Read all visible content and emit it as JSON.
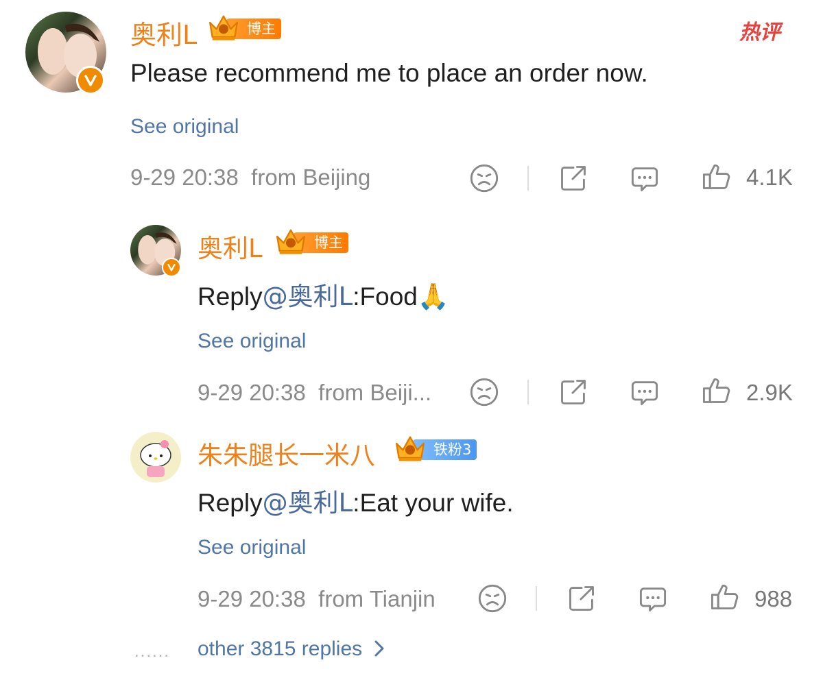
{
  "hot_label": "热评",
  "comments": [
    {
      "name": "奥利L",
      "badge": "博主",
      "badge_type": "blogger",
      "text": "Please recommend me to place an order now.",
      "see_original": "See original",
      "time": "9-29 20:38",
      "location": "from Beijing",
      "likes": "4.1K"
    },
    {
      "name": "奥利L",
      "badge": "博主",
      "badge_type": "blogger",
      "text_prefix": "Reply",
      "mention": "@奥利L",
      "text_body": ":Food🙏",
      "see_original": "See original",
      "time": "9-29 20:38",
      "location": "from Beiji...",
      "likes": "2.9K"
    },
    {
      "name": "朱朱腿长一米八",
      "badge": "铁粉3",
      "badge_type": "fan",
      "text_prefix": "Reply",
      "mention": "@奥利L",
      "text_body": ":Eat your wife.",
      "see_original": "See original",
      "time": "9-29 20:38",
      "location": "from Tianjin",
      "likes": "988"
    }
  ],
  "more_dots": "......",
  "more_replies": "other 3815 replies",
  "colors": {
    "name": "#f0811a",
    "link": "#5076a6",
    "meta": "#8a8a8a",
    "hot": "#e8423f",
    "blogger_badge": "#ff8a10",
    "fan_badge": "#5aa2f4"
  }
}
